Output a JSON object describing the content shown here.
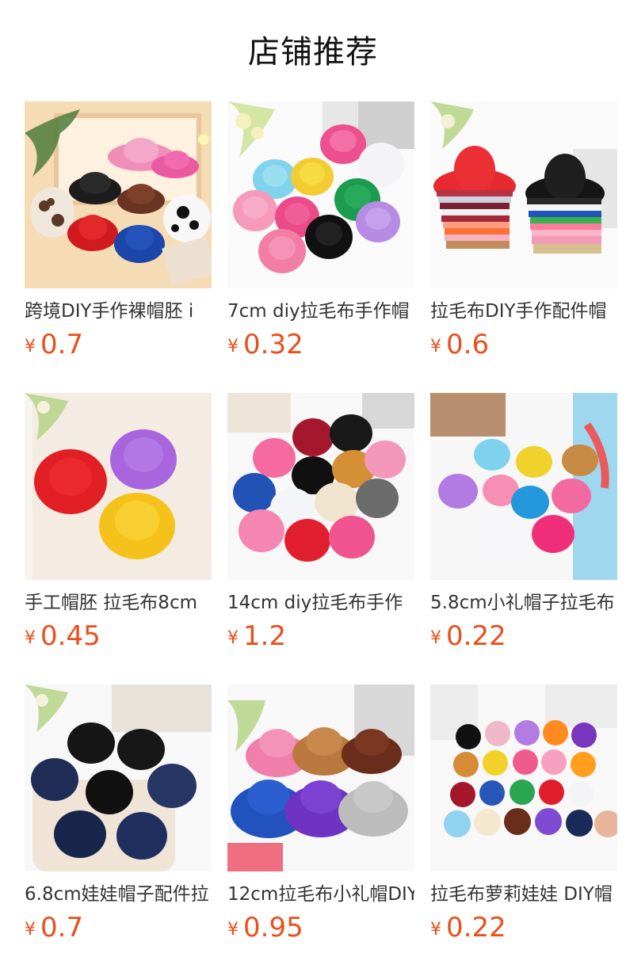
{
  "page": {
    "title": "店铺推荐"
  },
  "colors": {
    "price": "#ea4f1b",
    "title": "#111111",
    "name": "#333333"
  },
  "products": [
    {
      "name": "跨境DIY手作裸帽胚 i",
      "currency": "¥",
      "price": "0.7",
      "image": "assorted-mini-cowboy-hats"
    },
    {
      "name": "7cm diy拉毛布手作帽",
      "currency": "¥",
      "price": "0.32",
      "image": "colorful-mini-top-hats"
    },
    {
      "name": "拉毛布DIY手作配件帽",
      "currency": "¥",
      "price": "0.6",
      "image": "stacked-mini-hats-red-black"
    },
    {
      "name": "手工帽胚 拉毛布8cm",
      "currency": "¥",
      "price": "0.45",
      "image": "red-purple-yellow-mini-hats"
    },
    {
      "name": "14cm diy拉毛布手作",
      "currency": "¥",
      "price": "1.2",
      "image": "assorted-14cm-hats"
    },
    {
      "name": "5.8cm小礼帽子拉毛布",
      "currency": "¥",
      "price": "0.22",
      "image": "pastel-mini-hats"
    },
    {
      "name": "6.8cm娃娃帽子配件拉",
      "currency": "¥",
      "price": "0.7",
      "image": "black-navy-doll-hats"
    },
    {
      "name": "12cm拉毛布小礼帽DIY",
      "currency": "¥",
      "price": "0.95",
      "image": "pink-brown-blue-grey-hats"
    },
    {
      "name": "拉毛布萝莉娃娃 DIY帽",
      "currency": "¥",
      "price": "0.22",
      "image": "grid-of-mini-hats"
    }
  ]
}
